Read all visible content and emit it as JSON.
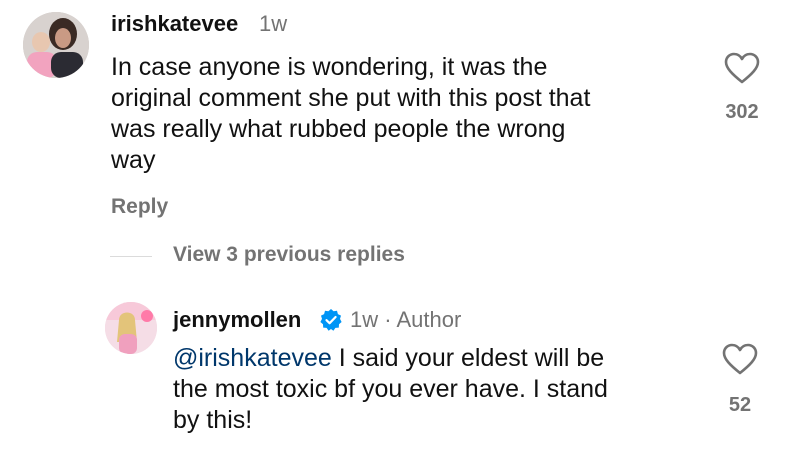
{
  "comment": {
    "username": "irishkatevee",
    "time": "1w",
    "text": "In case anyone is wondering, it was the original comment she put with this post that was really what rubbed people the wrong way",
    "text_lines": [
      "In case anyone is wondering, it was the",
      "original comment she put with this post that",
      "was really what rubbed people the wrong",
      "way"
    ],
    "reply_label": "Reply",
    "like_count": "302"
  },
  "replies": {
    "view_previous_label": "View 3 previous replies"
  },
  "reply": {
    "username": "jennymollen",
    "meta": "1w · Author",
    "mention": "@irishkatevee",
    "text_lines": [
      " I said your eldest will be",
      "the most toxic bf you ever have. I stand",
      "by this!"
    ],
    "like_count": "52"
  },
  "colors": {
    "secondary_text": "#737373",
    "mention": "#00376b",
    "verified_badge": "#0095f6"
  },
  "icons": {
    "like": "heart-outline-icon",
    "verified": "verified-badge-icon"
  }
}
